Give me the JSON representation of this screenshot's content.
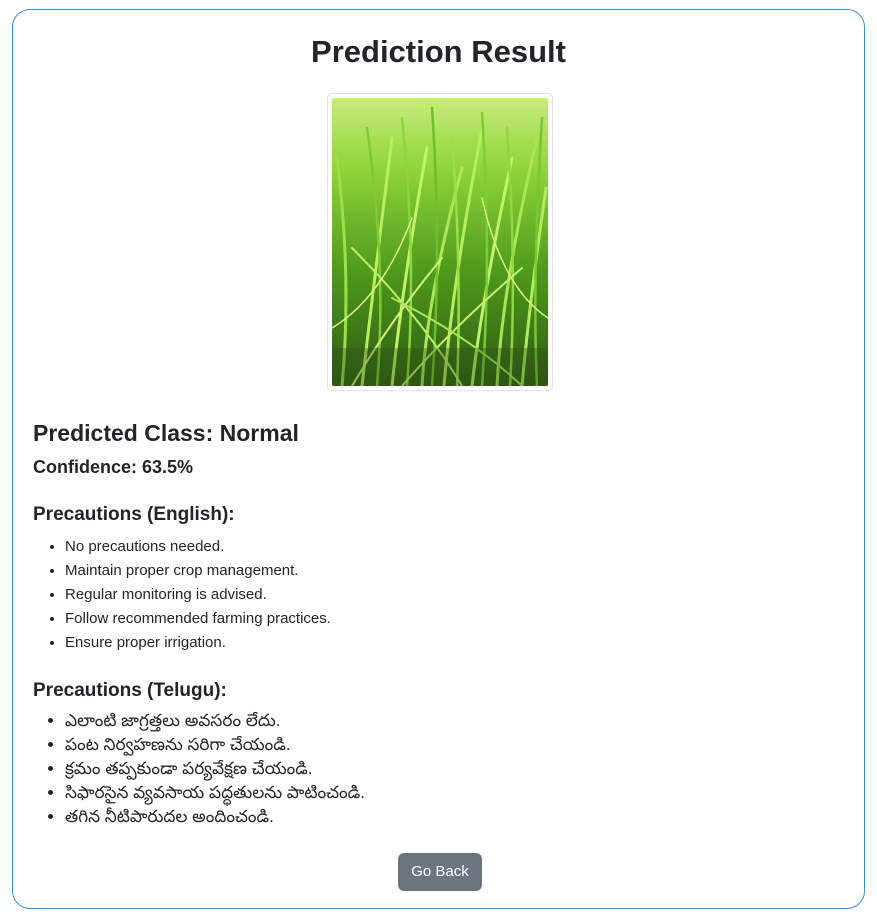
{
  "page": {
    "title": "Prediction Result"
  },
  "image": {
    "subject": "green rice crop field photo"
  },
  "result": {
    "predicted_class": "Predicted Class: Normal",
    "confidence": "Confidence: 63.5%"
  },
  "precautions_english": {
    "heading": "Precautions (English):",
    "items": [
      "No precautions needed.",
      "Maintain proper crop management.",
      "Regular monitoring is advised.",
      "Follow recommended farming practices.",
      "Ensure proper irrigation."
    ]
  },
  "precautions_telugu": {
    "heading": "Precautions (Telugu):",
    "items": [
      "ఎలాంటి జాగ్రత్తలు అవసరం లేదు.",
      "పంట నిర్వహణను సరిగా చేయండి.",
      "క్రమం తప్పకుండా పర్యవేక్షణ చేయండి.",
      "సిఫారసైన వ్యవసాయ పద్ధతులను పాటించండి.",
      "తగిన నీటిపారుదల అందించండి."
    ]
  },
  "actions": {
    "go_back_label": "Go Back"
  },
  "colors": {
    "card_border": "#3d8fd1",
    "button_bg": "#6c757d",
    "button_text": "#ffffff",
    "text": "#212529"
  }
}
